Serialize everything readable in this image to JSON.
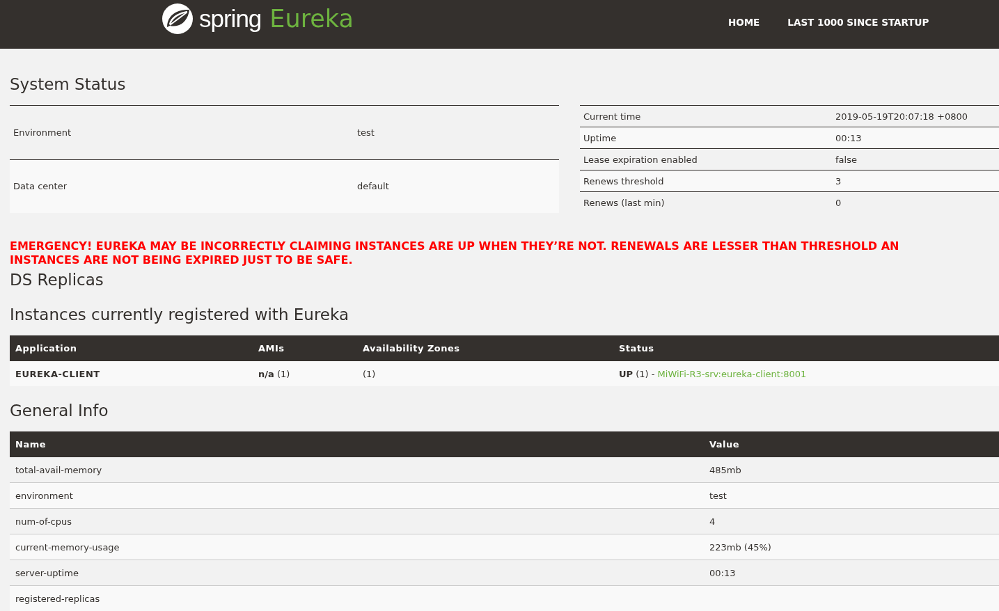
{
  "header": {
    "brand": "spring",
    "product": "Eureka",
    "nav": [
      {
        "label": "HOME"
      },
      {
        "label": "LAST 1000 SINCE STARTUP"
      }
    ]
  },
  "system_status": {
    "title": "System Status",
    "left": [
      {
        "name": "Environment",
        "value": "test"
      },
      {
        "name": "Data center",
        "value": "default"
      }
    ],
    "right": [
      {
        "name": "Current time",
        "value": "2019-05-19T20:07:18 +0800"
      },
      {
        "name": "Uptime",
        "value": "00:13"
      },
      {
        "name": "Lease expiration enabled",
        "value": "false"
      },
      {
        "name": "Renews threshold",
        "value": "3"
      },
      {
        "name": "Renews (last min)",
        "value": "0"
      }
    ]
  },
  "emergency_lines": [
    "EMERGENCY! EUREKA MAY BE INCORRECTLY CLAIMING INSTANCES ARE UP WHEN THEY’RE NOT. RENEWALS ARE LESSER THAN THRESHOLD AN",
    "INSTANCES ARE NOT BEING EXPIRED JUST TO BE SAFE."
  ],
  "ds_replicas": {
    "title": "DS Replicas"
  },
  "instances": {
    "title": "Instances currently registered with Eureka",
    "columns": [
      "Application",
      "AMIs",
      "Availability Zones",
      "Status"
    ],
    "rows": [
      {
        "application": "EUREKA-CLIENT",
        "amis": "**n/a** (1)",
        "zones": "(1)",
        "status": "**UP** (1) -",
        "link": "MiWiFi-R3-srv:eureka-client:8001"
      }
    ]
  },
  "general_info": {
    "title": "General Info",
    "columns": [
      "Name",
      "Value"
    ],
    "rows": [
      {
        "name": "total-avail-memory",
        "value": "485mb"
      },
      {
        "name": "environment",
        "value": "test"
      },
      {
        "name": "num-of-cpus",
        "value": "4"
      },
      {
        "name": "current-memory-usage",
        "value": "223mb (45%)"
      },
      {
        "name": "server-uptime",
        "value": "00:13"
      },
      {
        "name": "registered-replicas"
      }
    ]
  }
}
